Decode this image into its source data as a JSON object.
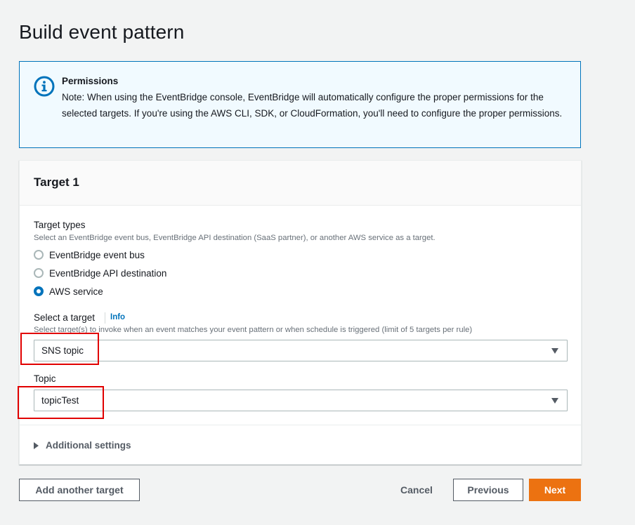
{
  "page": {
    "title": "Build event pattern"
  },
  "permissions_alert": {
    "icon": "info-icon",
    "title": "Permissions",
    "body": "Note: When using the EventBridge console, EventBridge will automatically configure the proper permissions for the selected targets. If you're using the AWS CLI, SDK, or CloudFormation, you'll need to configure the proper permissions."
  },
  "target": {
    "title": "Target 1",
    "types": {
      "label": "Target types",
      "description": "Select an EventBridge event bus, EventBridge API destination (SaaS partner), or another AWS service as a target.",
      "options": [
        {
          "label": "EventBridge event bus",
          "selected": false
        },
        {
          "label": "EventBridge API destination",
          "selected": false
        },
        {
          "label": "AWS service",
          "selected": true
        }
      ]
    },
    "select_target": {
      "label": "Select a target",
      "info_link": "Info",
      "description": "Select target(s) to invoke when an event matches your event pattern or when schedule is triggered (limit of 5 targets per rule)",
      "value": "SNS topic"
    },
    "topic": {
      "label": "Topic",
      "value": "topicTest"
    },
    "additional_settings": {
      "label": "Additional settings",
      "expanded": false
    }
  },
  "actions": {
    "add_target": "Add another target",
    "cancel": "Cancel",
    "previous": "Previous",
    "next": "Next"
  },
  "colors": {
    "accent": "#0073bb",
    "primary_button": "#ec7211",
    "highlight": "#e10000",
    "alert_background": "#f1faff"
  }
}
